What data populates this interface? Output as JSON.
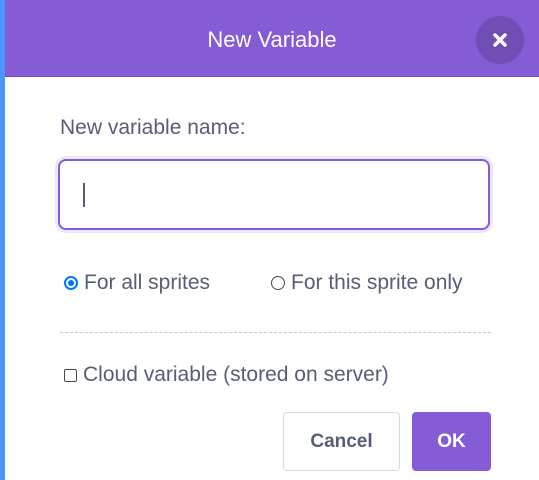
{
  "dialog": {
    "title": "New Variable",
    "close_icon": "close-icon",
    "name_label": "New variable name:",
    "name_value": "",
    "name_placeholder": "",
    "scope_options": [
      {
        "label": "For all sprites",
        "checked": true
      },
      {
        "label": "For this sprite only",
        "checked": false
      }
    ],
    "cloud_label": "Cloud variable (stored on server)",
    "cloud_checked": false,
    "cancel_label": "Cancel",
    "ok_label": "OK"
  },
  "colors": {
    "accent": "#855cd6",
    "text": "#575e75",
    "radio_blue": "#0075ff",
    "stage_edge_blue": "#4c97ff"
  }
}
